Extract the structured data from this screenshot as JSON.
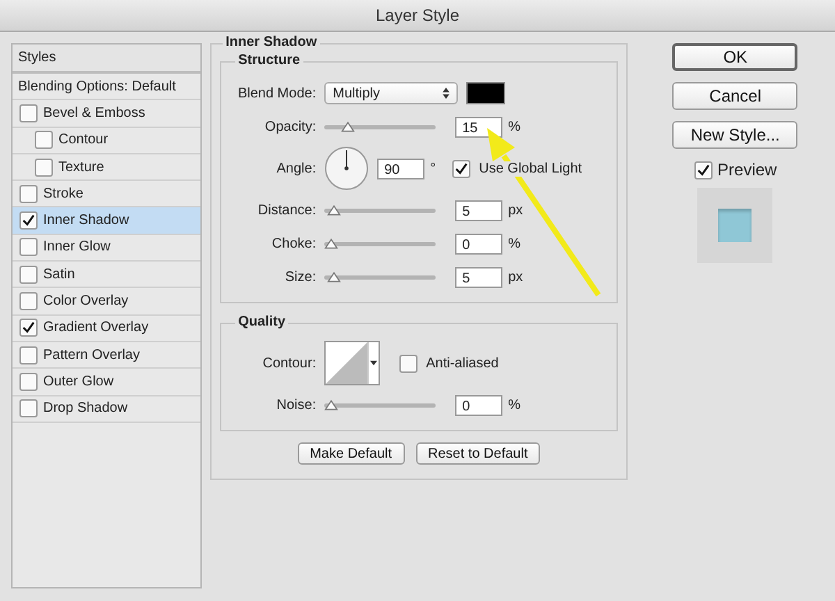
{
  "window": {
    "title": "Layer Style"
  },
  "sidebar": {
    "header": "Styles",
    "blending_options": "Blending Options: Default",
    "items": [
      {
        "label": "Bevel & Emboss",
        "checked": false,
        "selected": false,
        "children": [
          {
            "label": "Contour",
            "checked": false,
            "selected": false
          },
          {
            "label": "Texture",
            "checked": false,
            "selected": false
          }
        ]
      },
      {
        "label": "Stroke",
        "checked": false,
        "selected": false
      },
      {
        "label": "Inner Shadow",
        "checked": true,
        "selected": true
      },
      {
        "label": "Inner Glow",
        "checked": false,
        "selected": false
      },
      {
        "label": "Satin",
        "checked": false,
        "selected": false
      },
      {
        "label": "Color Overlay",
        "checked": false,
        "selected": false
      },
      {
        "label": "Gradient Overlay",
        "checked": true,
        "selected": false
      },
      {
        "label": "Pattern Overlay",
        "checked": false,
        "selected": false
      },
      {
        "label": "Outer Glow",
        "checked": false,
        "selected": false
      },
      {
        "label": "Drop Shadow",
        "checked": false,
        "selected": false
      }
    ]
  },
  "panel": {
    "title": "Inner Shadow",
    "structure": {
      "title": "Structure",
      "rows": [
        {
          "kind": "blend",
          "label": "Blend Mode:",
          "value": "Multiply",
          "color": "#000000"
        },
        {
          "kind": "slider",
          "label": "Opacity:",
          "value": "15",
          "unit": "%",
          "level": 0.15
        },
        {
          "kind": "angle",
          "label": "Angle:",
          "value": "90",
          "unit": "°",
          "global_light": {
            "label": "Use Global Light",
            "checked": true
          }
        },
        {
          "kind": "slider",
          "label": "Distance:",
          "value": "5",
          "unit": "px",
          "level": 0.02
        },
        {
          "kind": "slider",
          "label": "Choke:",
          "value": "0",
          "unit": "%",
          "level": 0
        },
        {
          "kind": "slider",
          "label": "Size:",
          "value": "5",
          "unit": "px",
          "level": 0.02
        }
      ]
    },
    "quality": {
      "title": "Quality",
      "rows": [
        {
          "kind": "contour",
          "label": "Contour:",
          "anti_aliased": {
            "label": "Anti-aliased",
            "checked": false
          }
        },
        {
          "kind": "slider",
          "label": "Noise:",
          "value": "0",
          "unit": "%",
          "level": 0
        }
      ]
    },
    "buttons": [
      "Make Default",
      "Reset to Default"
    ]
  },
  "actions": [
    {
      "label": "OK",
      "default": true
    },
    {
      "label": "Cancel",
      "default": false
    },
    {
      "label": "New Style...",
      "default": false
    }
  ],
  "preview": {
    "label": "Preview",
    "checked": true
  }
}
